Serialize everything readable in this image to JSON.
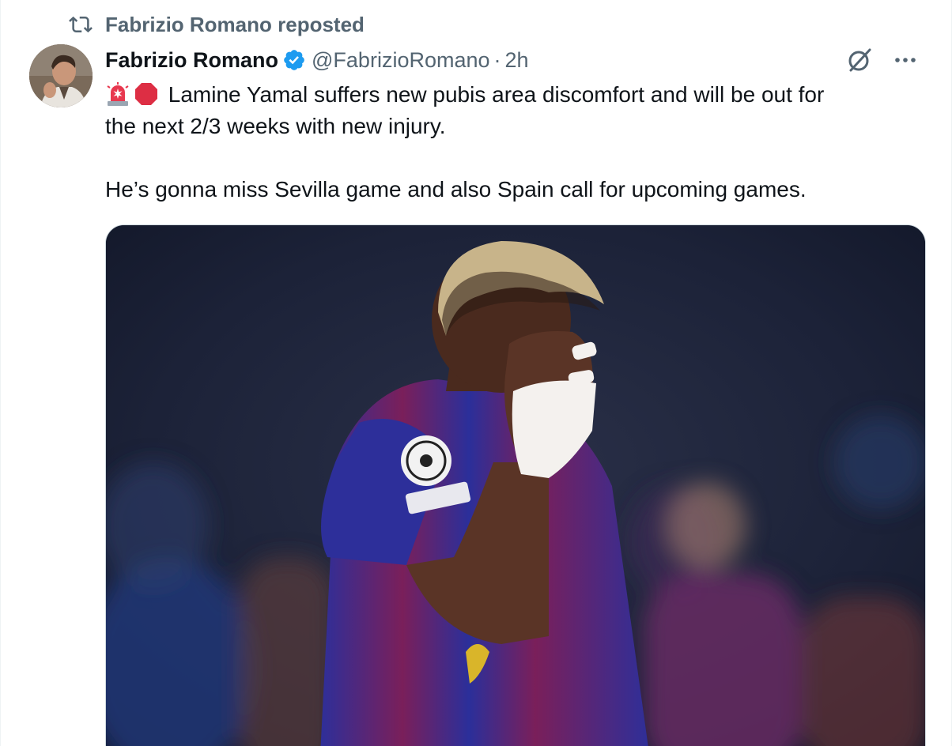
{
  "repost": {
    "icon": "repost-icon",
    "label": "Fabrizio Romano reposted"
  },
  "tweet": {
    "author": {
      "name": "Fabrizio Romano",
      "handle": "@FabrizioRomano",
      "verified_icon": "verified-badge-icon",
      "avatar_icon": "avatar"
    },
    "separator": "·",
    "time": "2h",
    "actions": {
      "grok_icon": "grok-icon",
      "more_icon": "more-icon"
    },
    "emojis": [
      "rotating-light-emoji",
      "stop-sign-emoji"
    ],
    "text_line_1": "Lamine Yamal suffers new pubis area discomfort and will be out for",
    "text_line_2": "the next 2/3 weeks with new injury.",
    "text_line_3": "He’s gonna miss Sevilla game and also Spain call for upcoming games.",
    "media": {
      "type": "photo",
      "icon": "photo-image"
    }
  },
  "colors": {
    "text": "#0f1419",
    "secondary": "#536471",
    "verified": "#1d9bf0",
    "border": "#cfd9de"
  }
}
